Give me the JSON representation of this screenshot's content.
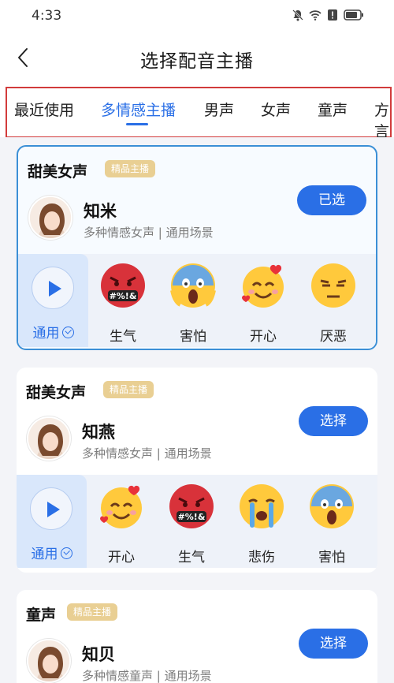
{
  "status": {
    "time": "4:33"
  },
  "nav": {
    "title": "选择配音主播"
  },
  "tabs": [
    "最近使用",
    "多情感主播",
    "男声",
    "女声",
    "童声",
    "方言"
  ],
  "cards": [
    {
      "title": "甜美女声",
      "badge": "精品主播",
      "name": "知米",
      "desc": "多种情感女声 | 通用场景",
      "button": "已选",
      "selected": true,
      "general": "通用",
      "emotions": [
        {
          "icon": "angry-face-icon",
          "label": "生气"
        },
        {
          "icon": "scared-face-icon",
          "label": "害怕"
        },
        {
          "icon": "happy-face-icon",
          "label": "开心"
        },
        {
          "icon": "disgust-face-icon",
          "label": "厌恶"
        }
      ]
    },
    {
      "title": "甜美女声",
      "badge": "精品主播",
      "name": "知燕",
      "desc": "多种情感女声 | 通用场景",
      "button": "选择",
      "selected": false,
      "general": "通用",
      "emotions": [
        {
          "icon": "happy-face-icon",
          "label": "开心"
        },
        {
          "icon": "angry-face-icon",
          "label": "生气"
        },
        {
          "icon": "crying-face-icon",
          "label": "悲伤"
        },
        {
          "icon": "scared-face-icon",
          "label": "害怕"
        }
      ]
    },
    {
      "title": "童声",
      "badge": "精品主播",
      "name": "知贝",
      "desc": "多种情感童声 | 通用场景",
      "button": "选择",
      "selected": false
    }
  ],
  "colors": {
    "accent": "#2a6fe6",
    "badge": "#e9cf93",
    "selected_border": "#3b8fd6",
    "tabs_outline": "#d23b3b"
  }
}
